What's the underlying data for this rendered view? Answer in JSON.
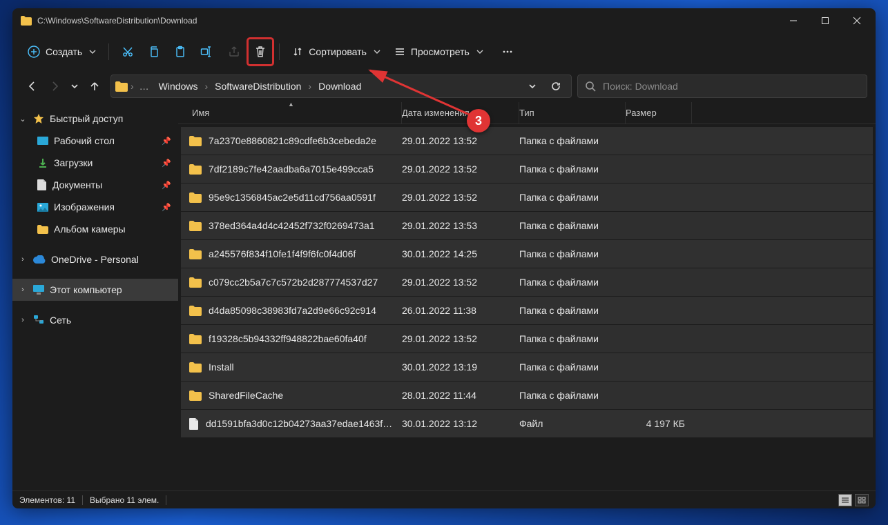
{
  "window": {
    "title": "C:\\Windows\\SoftwareDistribution\\Download"
  },
  "toolbar": {
    "new_label": "Создать",
    "sort_label": "Сортировать",
    "view_label": "Просмотреть"
  },
  "breadcrumb": {
    "a": "Windows",
    "b": "SoftwareDistribution",
    "c": "Download"
  },
  "search": {
    "placeholder": "Поиск: Download"
  },
  "columns": {
    "name": "Имя",
    "date": "Дата изменения",
    "type": "Тип",
    "size": "Размер"
  },
  "sidebar": {
    "quick": "Быстрый доступ",
    "desktop": "Рабочий стол",
    "downloads": "Загрузки",
    "documents": "Документы",
    "pictures": "Изображения",
    "camera": "Альбом камеры",
    "onedrive": "OneDrive - Personal",
    "thispc": "Этот компьютер",
    "network": "Сеть"
  },
  "rows": [
    {
      "name": "7a2370e8860821c89cdfe6b3cebeda2e",
      "date": "29.01.2022 13:52",
      "type": "Папка с файлами",
      "size": "",
      "kind": "folder"
    },
    {
      "name": "7df2189c7fe42aadba6a7015e499cca5",
      "date": "29.01.2022 13:52",
      "type": "Папка с файлами",
      "size": "",
      "kind": "folder"
    },
    {
      "name": "95e9c1356845ac2e5d11cd756aa0591f",
      "date": "29.01.2022 13:52",
      "type": "Папка с файлами",
      "size": "",
      "kind": "folder"
    },
    {
      "name": "378ed364a4d4c42452f732f0269473a1",
      "date": "29.01.2022 13:53",
      "type": "Папка с файлами",
      "size": "",
      "kind": "folder"
    },
    {
      "name": "a245576f834f10fe1f4f9f6fc0f4d06f",
      "date": "30.01.2022 14:25",
      "type": "Папка с файлами",
      "size": "",
      "kind": "folder"
    },
    {
      "name": "c079cc2b5a7c7c572b2d287774537d27",
      "date": "29.01.2022 13:52",
      "type": "Папка с файлами",
      "size": "",
      "kind": "folder"
    },
    {
      "name": "d4da85098c38983fd7a2d9e66c92c914",
      "date": "26.01.2022 11:38",
      "type": "Папка с файлами",
      "size": "",
      "kind": "folder"
    },
    {
      "name": "f19328c5b94332ff948822bae60fa40f",
      "date": "29.01.2022 13:52",
      "type": "Папка с файлами",
      "size": "",
      "kind": "folder"
    },
    {
      "name": "Install",
      "date": "30.01.2022 13:19",
      "type": "Папка с файлами",
      "size": "",
      "kind": "folder"
    },
    {
      "name": "SharedFileCache",
      "date": "28.01.2022 11:44",
      "type": "Папка с файлами",
      "size": "",
      "kind": "folder"
    },
    {
      "name": "dd1591bfa3d0c12b04273aa37edae1463f…",
      "date": "30.01.2022 13:12",
      "type": "Файл",
      "size": "4 197 КБ",
      "kind": "file"
    }
  ],
  "status": {
    "count": "Элементов: 11",
    "selected": "Выбрано 11 элем."
  },
  "annotation": {
    "label": "3"
  },
  "icons": {
    "folder_color": "#f3c14b",
    "accent": "#4cc2ff",
    "highlight": "#d13030"
  }
}
